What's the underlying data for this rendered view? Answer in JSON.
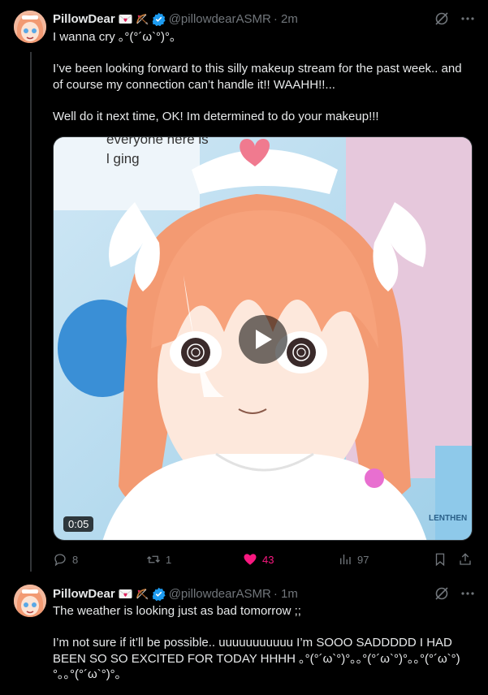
{
  "tweets": [
    {
      "display_name": "PillowDear",
      "handle": "@pillowdearASMR",
      "time": "· 2m",
      "text": "I wanna cry ｡°(°´ω`°)°｡\n\nI’ve been looking forward to this silly makeup stream for the past week.. and of course my connection can’t handle it!! WAAHH!!...\n\nWell do it next time, OK! Im determined to do your makeup!!!",
      "video": {
        "duration": "0:05",
        "overlay_text_line1": "everyone here is",
        "overlay_text_line2": "l    ging",
        "watermark": "LENTHEN"
      },
      "actions": {
        "replies": "8",
        "reposts": "1",
        "likes": "43",
        "views": "97"
      }
    },
    {
      "display_name": "PillowDear",
      "handle": "@pillowdearASMR",
      "time": "· 1m",
      "text": "The weather is looking just as bad tomorrow ;;\n\nI’m not sure if it’ll be possible.. uuuuuuuuuuu I’m SOOO SADDDDD I HAD BEEN SO SO EXCITED FOR TODAY HHHH ｡°(°´ω`°)°｡｡°(°´ω`°)°｡｡°(°´ω`°)°｡｡°(°´ω`°)°｡"
    }
  ],
  "colors": {
    "background": "#000000",
    "text": "#e7e9ea",
    "muted": "#71767b",
    "like": "#f91880",
    "verified": "#1d9bf0"
  }
}
